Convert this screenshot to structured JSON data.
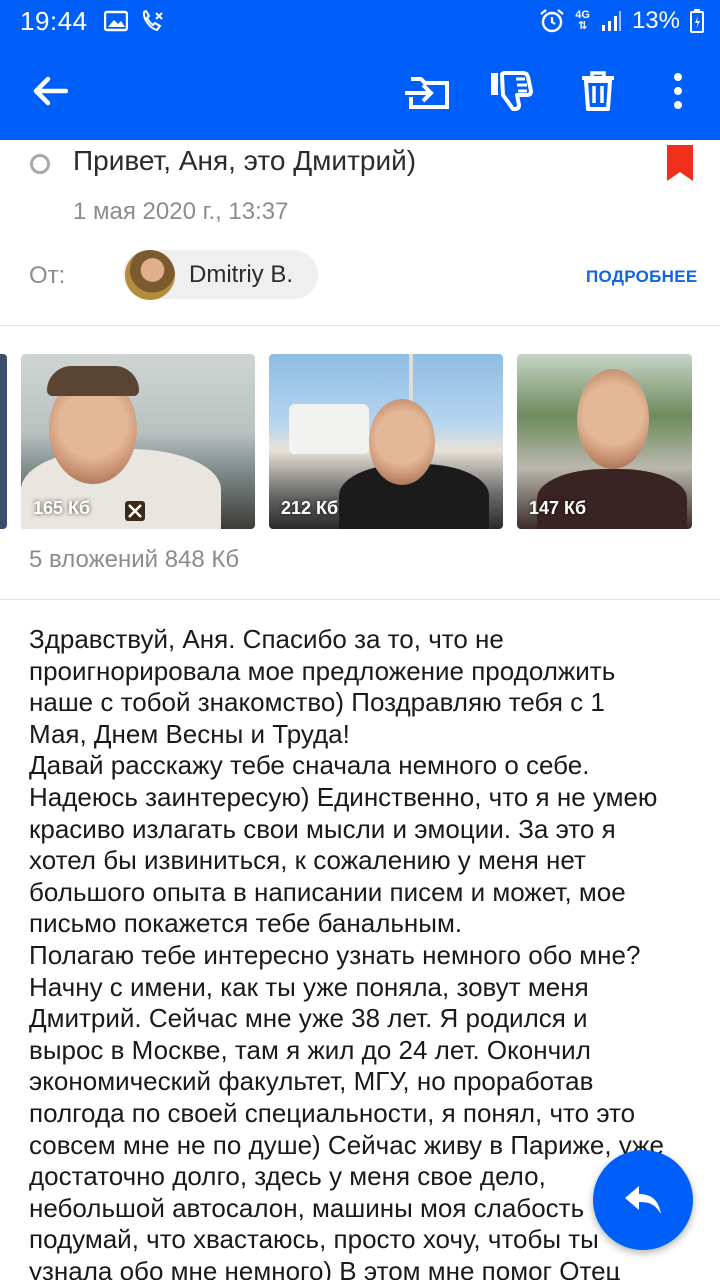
{
  "status_bar": {
    "time": "19:44",
    "network": "4G",
    "battery": "13%"
  },
  "toolbar": {
    "back_icon": "arrow-left-icon",
    "move_icon": "move-to-folder-icon",
    "spam_icon": "thumbs-down-icon",
    "delete_icon": "trash-icon",
    "more_icon": "more-vertical-icon"
  },
  "message": {
    "subject": "Привет, Аня, это Дмитрий)",
    "date": "1 мая 2020 г., 13:37",
    "from_label": "От:",
    "sender_name": "Dmitriy B.",
    "details_link": "ПОДРОБНЕЕ",
    "flag_color": "#f0301a"
  },
  "attachments": {
    "items": [
      {
        "size": "165 Кб"
      },
      {
        "size": "212 Кб"
      },
      {
        "size": "147 Кб"
      }
    ],
    "summary": "5 вложений 848  Кб"
  },
  "body": "Здравствуй, Аня. Спасибо за то, что не\nпроигнорировала мое предложение продолжить\nнаше с тобой знакомство) Поздравляю тебя с 1\nМая, Днем Весны и Труда!\nДавай расскажу тебе сначала немного о себе.\nНадеюсь заинтересую) Единственно, что я не умею\nкрасиво излагать свои мысли и эмоции. За это я\nхотел бы извиниться, к сожалению у меня нет\nбольшого опыта в написании писем и может, мое\nписьмо покажется тебе банальным.\nПолагаю тебе интересно узнать немного обо мне?\nНачну с имени, как ты уже поняла, зовут меня\nДмитрий. Сейчас мне уже 38 лет. Я родился и\nвырос в Москве, там я жил до 24 лет. Окончил\nэкономический факультет, МГУ, но проработав\nполгода по своей специальности, я понял, что это\nсовсем мне не по душе) Сейчас живу в Париже, уже\nдостаточно долго, здесь у меня свое дело,\nнебольшой автосалон, машины моя слабость\nподумай, что хвастаюсь, просто хочу, чтобы ты\nузнала обо мне немного) В этом мне помог Отец",
  "reply_fab": {
    "icon": "reply-icon"
  },
  "colors": {
    "brand": "#005ff9",
    "link": "#1266e0"
  }
}
